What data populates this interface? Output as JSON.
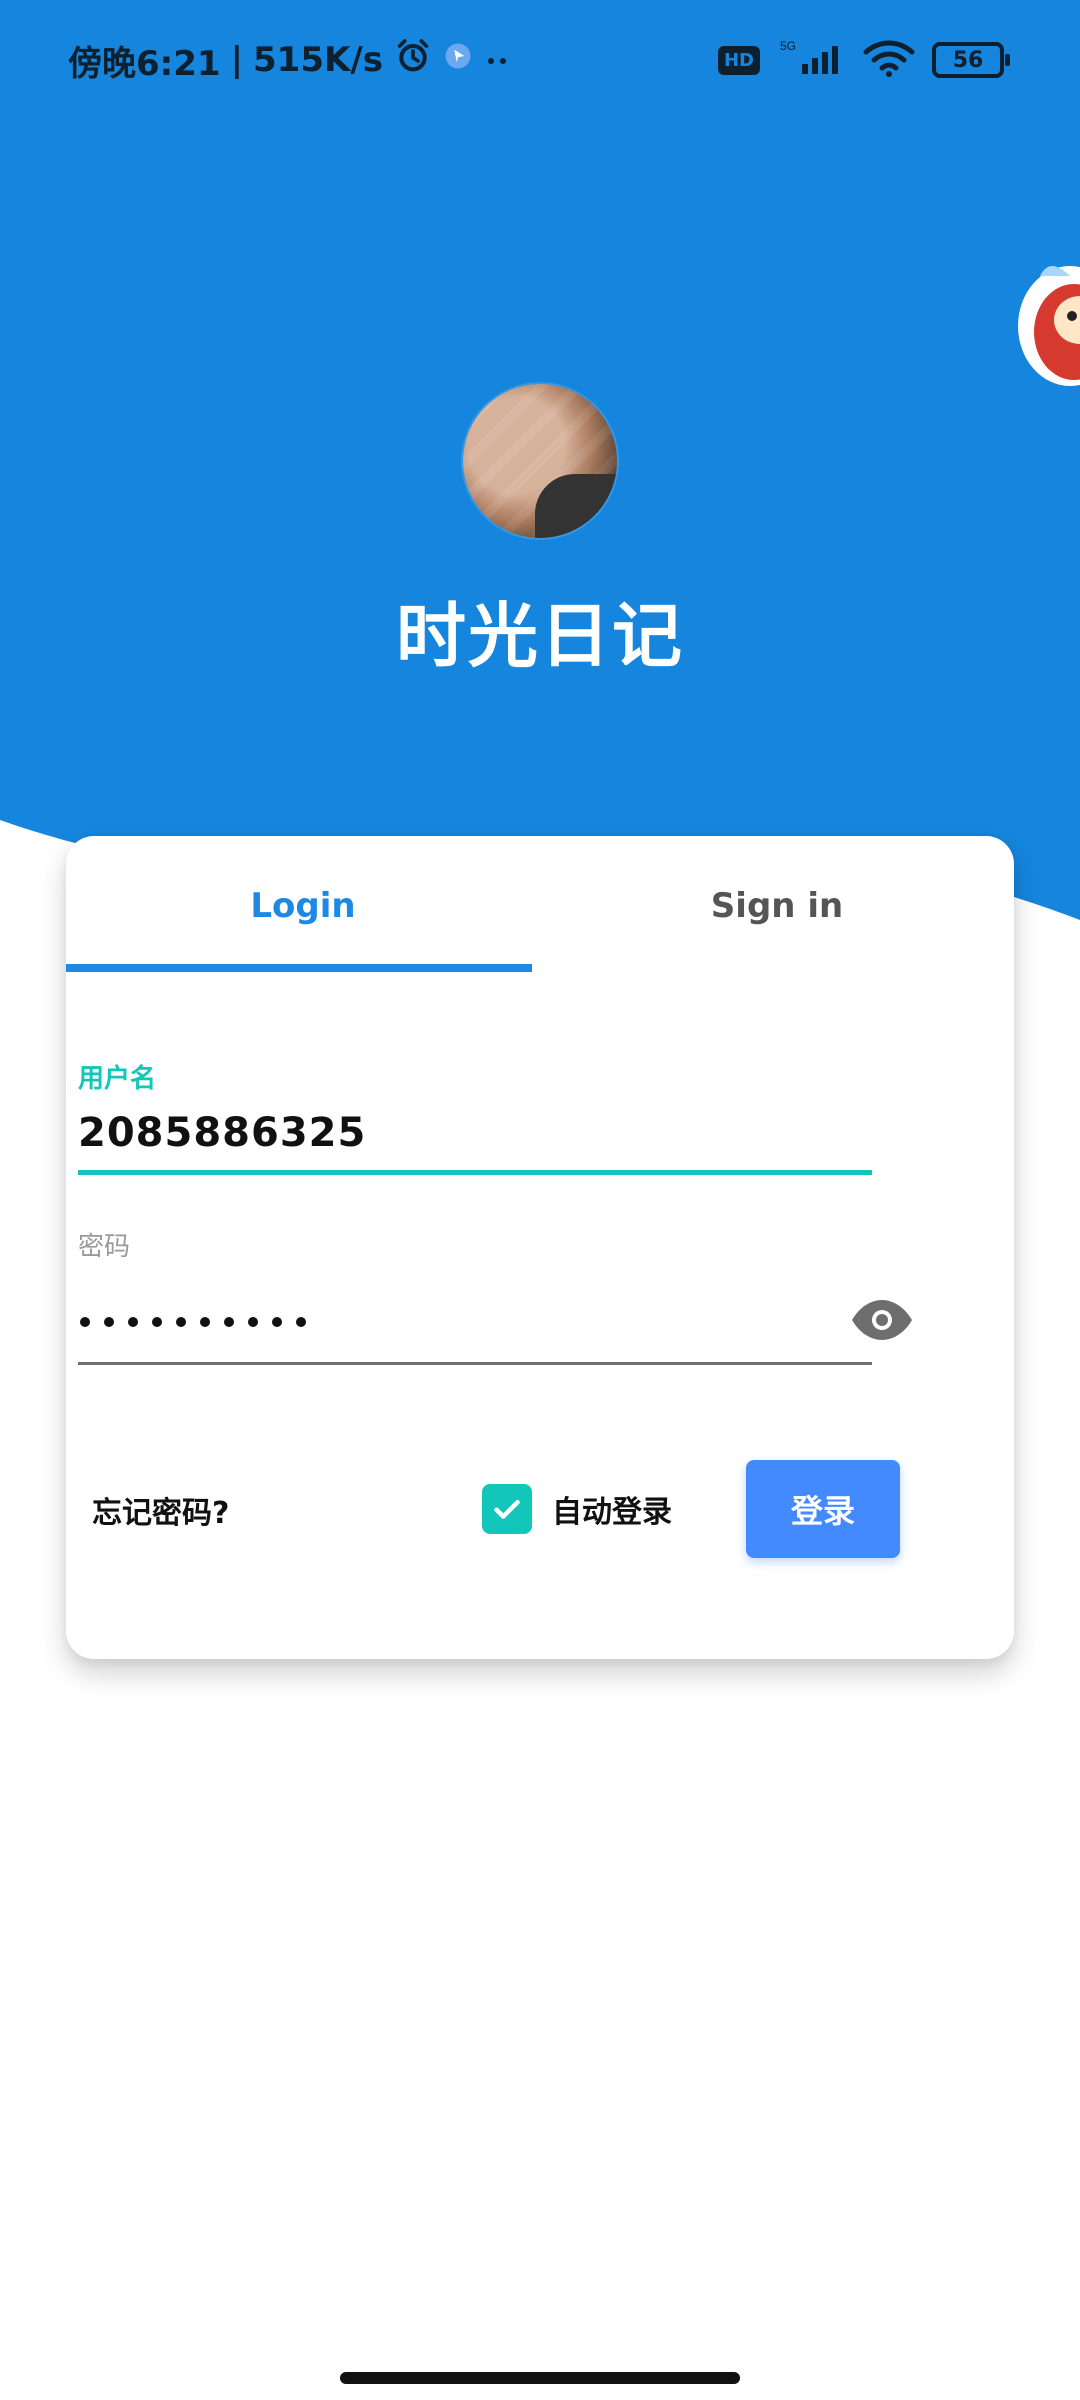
{
  "status_bar": {
    "time_text": "傍晚6:21",
    "speed_text": "515K/s",
    "hd_label": "HD",
    "network_label": "5G",
    "battery_level": "56"
  },
  "app": {
    "title": "时光日记"
  },
  "tabs": [
    {
      "label": "Login",
      "active": true
    },
    {
      "label": "Sign in",
      "active": false
    }
  ],
  "form": {
    "username_label": "用户名",
    "username_value": "2085886325",
    "password_label": "密码",
    "password_mask": "••••••••••"
  },
  "actions": {
    "forgot_password": "忘记密码?",
    "auto_login": "自动登录",
    "auto_login_checked": true,
    "login_button": "登录"
  },
  "colors": {
    "primary_blue": "#1585dd",
    "accent_teal": "#12c7b9",
    "button_blue": "#448aff"
  }
}
